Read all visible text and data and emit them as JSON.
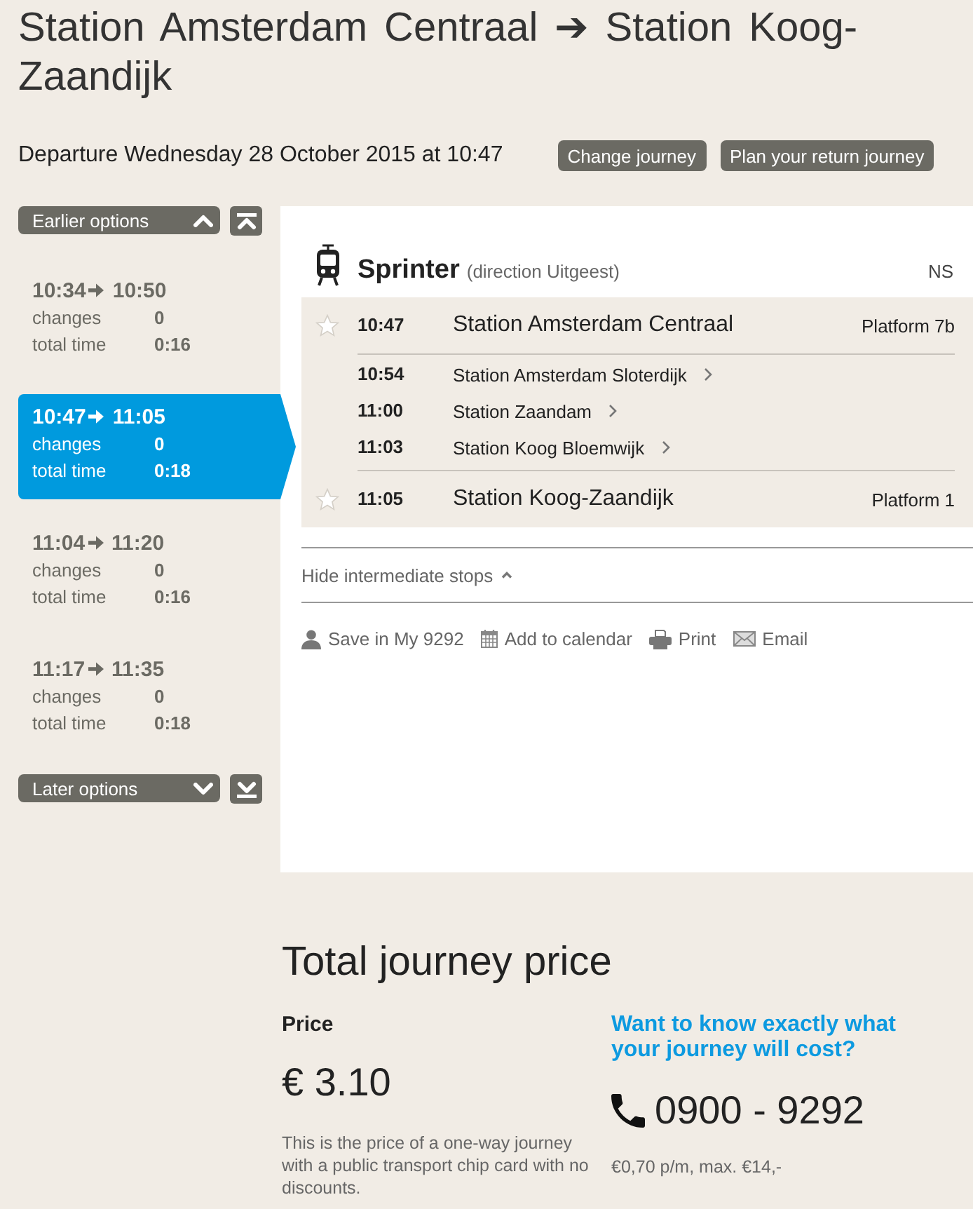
{
  "title": "Station Amsterdam Centraal ➔ Station Koog-Zaandijk",
  "departure": "Departure Wednesday 28 October 2015 at 10:47",
  "header_buttons": [
    "Change journey",
    "Plan your return journey"
  ],
  "earlier_button": "Earlier options",
  "options": [
    {
      "depart": "10:34",
      "arrive": "10:50",
      "changes_label": "changes",
      "changes": "0",
      "time_label": "total time",
      "total_time": "0:16",
      "selected": false
    },
    {
      "depart": "10:47",
      "arrive": "11:05",
      "changes_label": "changes",
      "changes": "0",
      "time_label": "total time",
      "total_time": "0:18",
      "selected": true
    },
    {
      "depart": "11:04",
      "arrive": "11:20",
      "changes_label": "changes",
      "changes": "0",
      "time_label": "total time",
      "total_time": "0:16",
      "selected": false
    },
    {
      "depart": "11:17",
      "arrive": "11:35",
      "changes_label": "changes",
      "changes": "0",
      "time_label": "total time",
      "total_time": "0:18",
      "selected": false
    }
  ],
  "later_button": "Later options",
  "leg": {
    "service": "Sprinter",
    "direction": "(direction Uitgeest)",
    "operator": "NS",
    "stops": [
      {
        "kind": "endpoint",
        "time": "10:47",
        "name": "Station Amsterdam Centraal",
        "platform": "Platform 7b"
      },
      {
        "kind": "intermediate",
        "time": "10:54",
        "name": "Station Amsterdam Sloterdijk"
      },
      {
        "kind": "intermediate",
        "time": "11:00",
        "name": "Station Zaandam"
      },
      {
        "kind": "intermediate",
        "time": "11:03",
        "name": "Station Koog Bloemwijk"
      },
      {
        "kind": "endpoint",
        "time": "11:05",
        "name": "Station Koog-Zaandijk",
        "platform": "Platform 1"
      }
    ]
  },
  "toggle_stops": "Hide intermediate stops",
  "actions": [
    {
      "kind": "save",
      "label": "Save in My 9292"
    },
    {
      "kind": "calendar",
      "label": "Add to calendar"
    },
    {
      "kind": "print",
      "label": "Print"
    },
    {
      "kind": "email",
      "label": "Email"
    }
  ],
  "price": {
    "title": "Total journey price",
    "label": "Price",
    "amount": "€ 3.10",
    "note": "This is the price of a one-way journey with a public transport chip card with no discounts."
  },
  "help": {
    "question": "Want to know exactly what your journey will cost?",
    "phone": "0900 - 9292",
    "rate": "€0,70 p/m, max. €14,-"
  }
}
